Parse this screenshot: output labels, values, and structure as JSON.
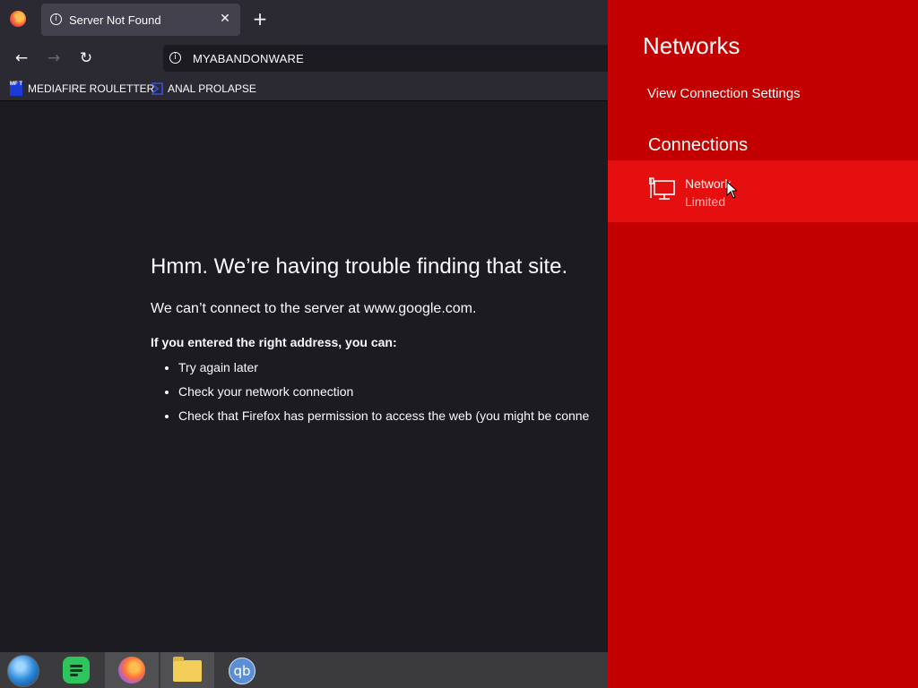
{
  "browser": {
    "tab": {
      "title": "Server Not Found",
      "close_glyph": "✕"
    },
    "new_tab_glyph": "+",
    "nav": {
      "back": "←",
      "forward": "→",
      "reload": "↻"
    },
    "url": {
      "text": "MYABANDONWARE",
      "info_glyph": "i"
    },
    "bookmarks": [
      {
        "label": "MEDIAFIRE ROULETTER",
        "icon": "mediafire-icon",
        "icon_text": "MF T"
      },
      {
        "label": "ANAL PROLAPSE",
        "icon": "sigma-icon"
      }
    ],
    "error": {
      "title": "Hmm. We’re having trouble finding that site.",
      "description": "We can’t connect to the server at www.google.com.",
      "hint": "If you entered the right address, you can:",
      "suggestions": [
        "Try again later",
        "Check your network connection",
        "Check that Firefox has permission to access the web (you might be conne"
      ]
    }
  },
  "taskbar": {
    "apps": [
      "start-orb",
      "green-notes-app",
      "firefox",
      "file-explorer",
      "qbittorrent"
    ],
    "qb_label": "qb"
  },
  "flyout": {
    "title": "Networks",
    "settings_link": "View Connection Settings",
    "section": "Connections",
    "connection": {
      "name": "Network",
      "status": "Limited",
      "icon": "ethernet-icon"
    }
  },
  "colors": {
    "flyout_bg": "#c20000",
    "flyout_selected": "#e60f0f",
    "browser_bg": "#1c1b22",
    "chrome_bg": "#2b2a33"
  }
}
